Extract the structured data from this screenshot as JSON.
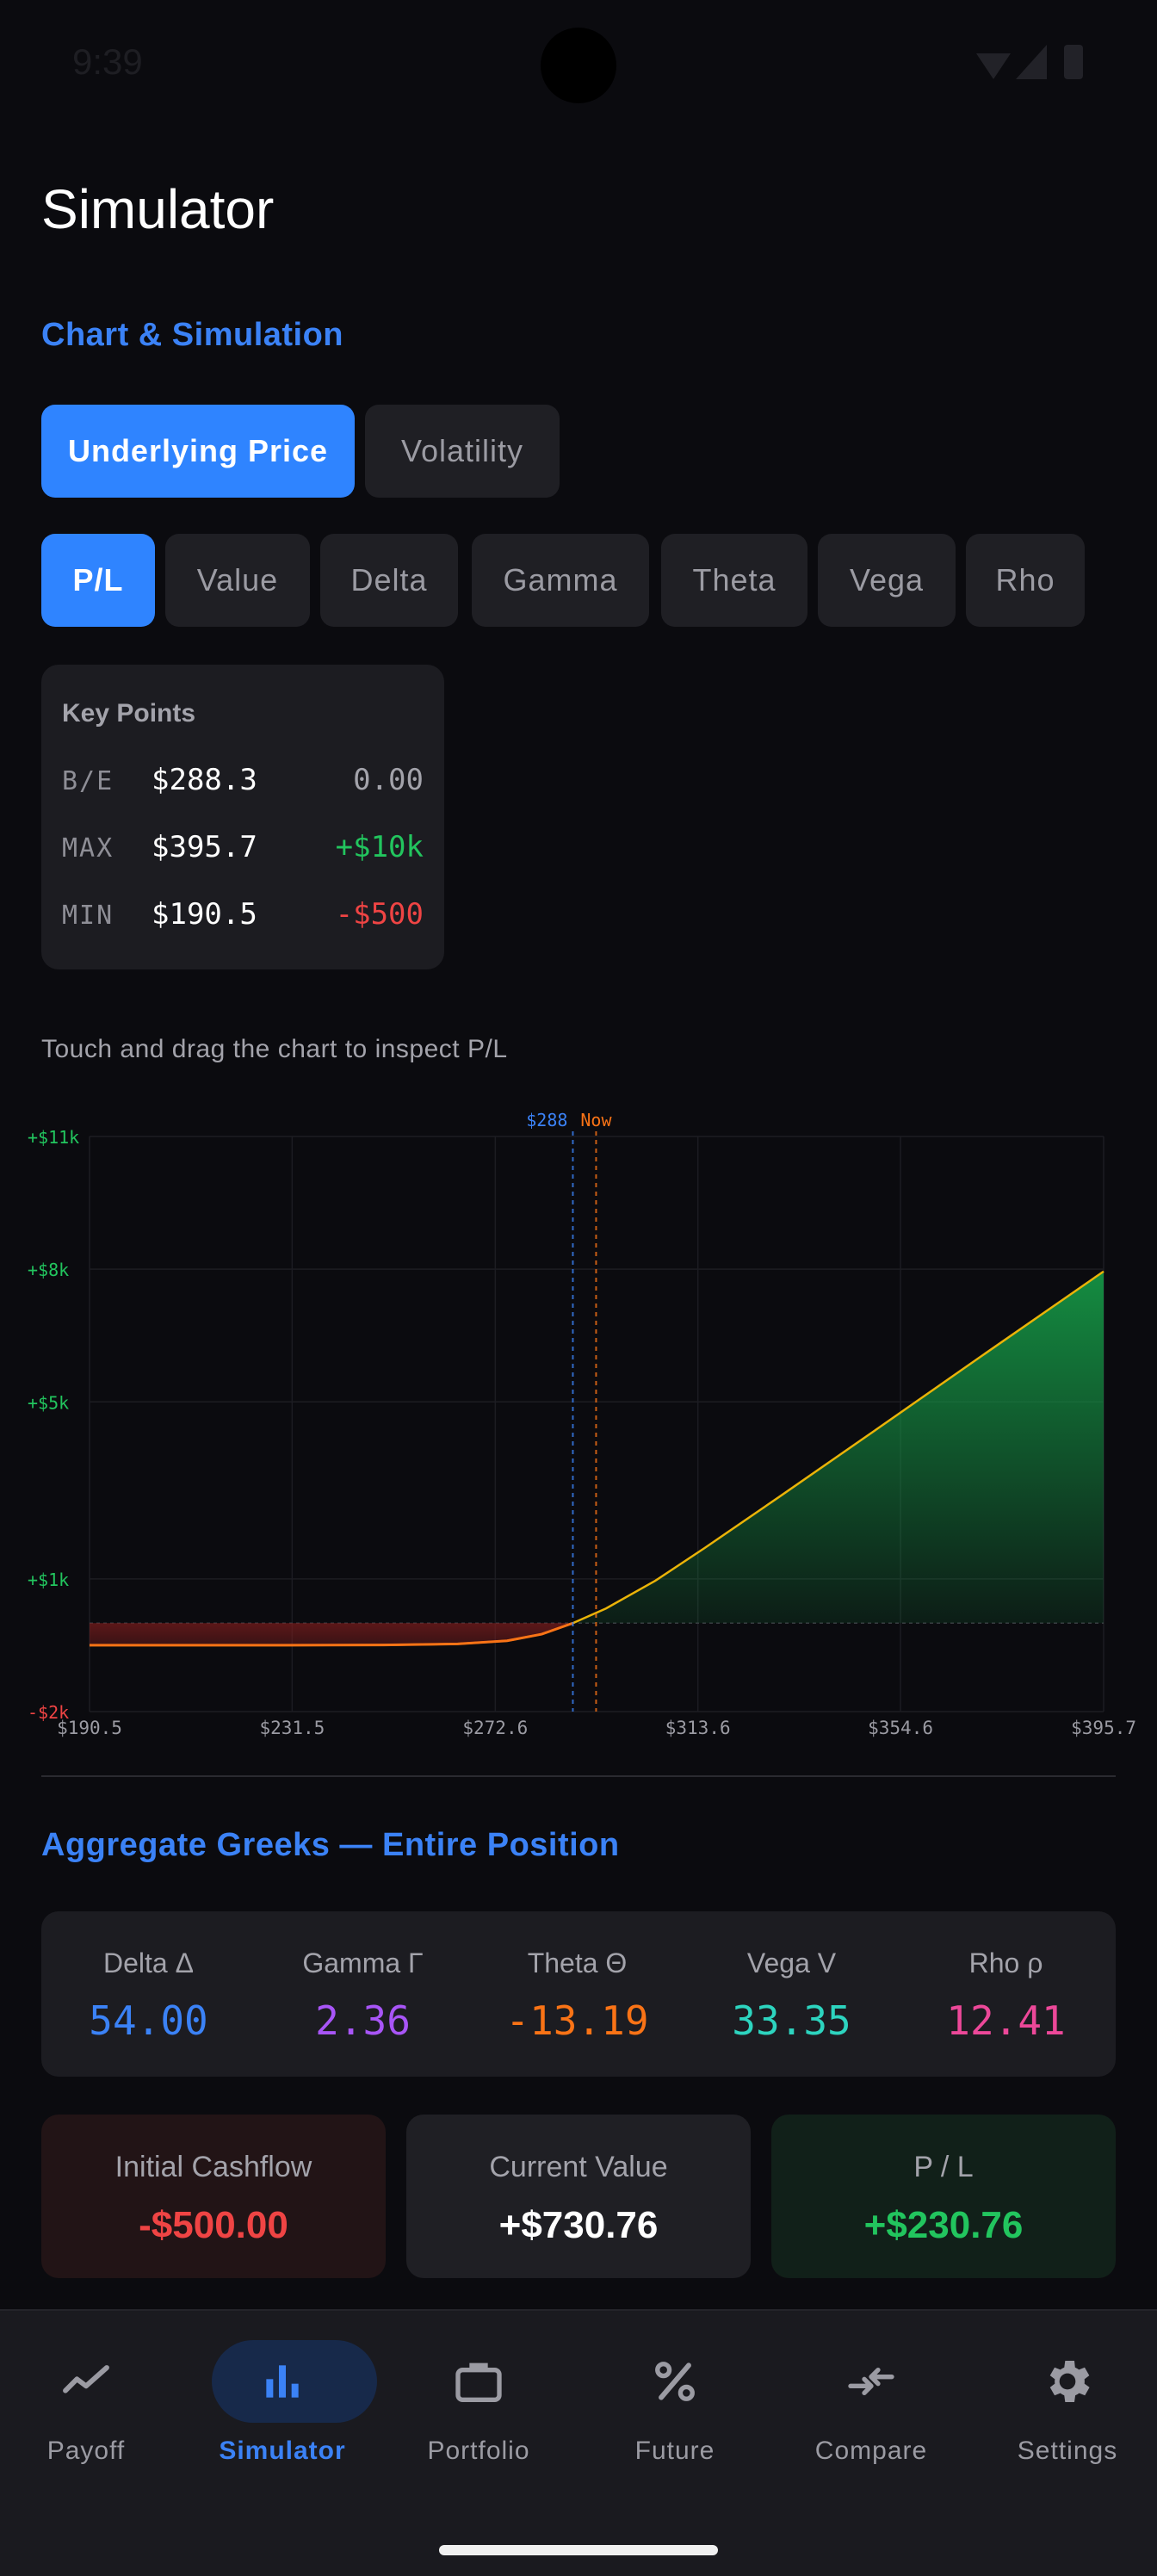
{
  "status_bar": {
    "time": "9:39"
  },
  "page_title": "Simulator",
  "chart_section": {
    "title": "Chart & Simulation",
    "mode_tabs": [
      {
        "label": "Underlying Price",
        "active": true
      },
      {
        "label": "Volatility",
        "active": false
      }
    ],
    "metric_tabs": [
      {
        "label": "P/L",
        "active": true
      },
      {
        "label": "Value",
        "active": false
      },
      {
        "label": "Delta",
        "active": false
      },
      {
        "label": "Gamma",
        "active": false
      },
      {
        "label": "Theta",
        "active": false
      },
      {
        "label": "Vega",
        "active": false
      },
      {
        "label": "Rho",
        "active": false
      }
    ],
    "key_points": {
      "title": "Key Points",
      "rows": [
        {
          "label": "B/E",
          "price": "$288.3",
          "value": "0.00",
          "color": "#a3a3ab"
        },
        {
          "label": "MAX",
          "price": "$395.7",
          "value": "+$10k",
          "color": "#22c55e"
        },
        {
          "label": "MIN",
          "price": "$190.5",
          "value": "-$500",
          "color": "#ef4444"
        }
      ]
    },
    "hint": "Touch and drag the chart to inspect P/L"
  },
  "chart_data": {
    "type": "area",
    "title": "",
    "xlabel": "",
    "ylabel": "",
    "x_ticks": [
      "$190.5",
      "$231.5",
      "$272.6",
      "$313.6",
      "$354.6",
      "$395.7"
    ],
    "y_ticks": [
      "+$11k",
      "+$8k",
      "+$5k",
      "+$1k",
      "-$2k"
    ],
    "xlim": [
      190.5,
      395.7
    ],
    "ylim": [
      -2000,
      11000
    ],
    "markers": [
      {
        "label": "$288",
        "x": 288.3,
        "color": "#3b82f6"
      },
      {
        "label": "Now",
        "x": 293.0,
        "color": "#f97316"
      }
    ],
    "series": [
      {
        "x": [
          190.5,
          210,
          230,
          250,
          265,
          275,
          282,
          288.3,
          295,
          305,
          315,
          330,
          350,
          370,
          395.7
        ],
        "values": [
          -500,
          -500,
          -500,
          -495,
          -470,
          -400,
          -250,
          0,
          330,
          960,
          1700,
          2850,
          4400,
          5960,
          7950
        ]
      }
    ],
    "colors": {
      "gain": "#22c55e",
      "loss": "#ef4444",
      "line": "#eab308"
    }
  },
  "greeks_section": {
    "title": "Aggregate Greeks — Entire Position",
    "items": [
      {
        "name": "Delta Δ",
        "value": "54.00",
        "color": "#3b82f6"
      },
      {
        "name": "Gamma Γ",
        "value": "2.36",
        "color": "#a855f7"
      },
      {
        "name": "Theta Θ",
        "value": "-13.19",
        "color": "#f97316"
      },
      {
        "name": "Vega V",
        "value": "33.35",
        "color": "#2dd4bf"
      },
      {
        "name": "Rho ρ",
        "value": "12.41",
        "color": "#ec4899"
      }
    ]
  },
  "summary": {
    "initial_cashflow": {
      "label": "Initial Cashflow",
      "value": "-$500.00"
    },
    "current_value": {
      "label": "Current Value",
      "value": "+$730.76"
    },
    "pl": {
      "label": "P / L",
      "value": "+$230.76"
    }
  },
  "nav": {
    "items": [
      {
        "label": "Payoff",
        "icon": "trend-line-icon",
        "active": false
      },
      {
        "label": "Simulator",
        "icon": "bar-chart-icon",
        "active": true
      },
      {
        "label": "Portfolio",
        "icon": "briefcase-icon",
        "active": false
      },
      {
        "label": "Future",
        "icon": "percent-icon",
        "active": false
      },
      {
        "label": "Compare",
        "icon": "compare-arrows-icon",
        "active": false
      },
      {
        "label": "Settings",
        "icon": "gear-icon",
        "active": false
      }
    ]
  }
}
